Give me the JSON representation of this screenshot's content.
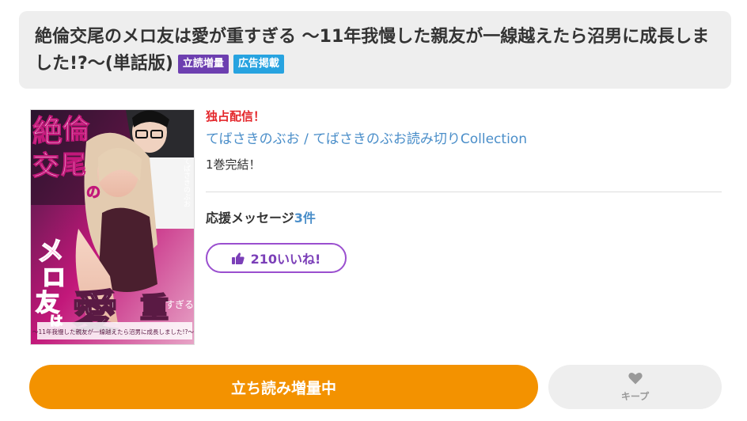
{
  "title": {
    "text": "絶倫交尾のメロ友は愛が重すぎる ～11年我慢した親友が一線越えたら沼男に成長しました!?～(単話版)",
    "badges": [
      "立読増量",
      "広告掲載"
    ]
  },
  "cover": {
    "alt": "絶倫交尾のメロ友は愛が重すぎる",
    "cover_title_chars": [
      "絶",
      "倫",
      "交",
      "尾",
      "の",
      "メ",
      "ロ",
      "友",
      "は",
      "愛",
      "重",
      "すぎる"
    ],
    "cover_subtitle": "～11年我慢した親友が一線越えたら沼男に成長しました!?～",
    "cover_author": "てばさきのぶお"
  },
  "info": {
    "exclusive": "独占配信！",
    "author": "てばさきのぶお",
    "separator": " / ",
    "label": "てばさきのぶお読み切りCollection",
    "volumes": "1巻完結！"
  },
  "support": {
    "label": "応援メッセージ",
    "count": "3件"
  },
  "like": {
    "label": "210いいね!"
  },
  "actions": {
    "read_label": "立ち読み増量中",
    "keep_label": "キープ"
  },
  "colors": {
    "accent_orange": "#f39200",
    "badge_purple": "#6d3fb0",
    "badge_blue": "#27a3e0",
    "link_blue": "#4a8ec9",
    "alert_red": "#e4262b",
    "like_purple": "#9a4fcf"
  }
}
